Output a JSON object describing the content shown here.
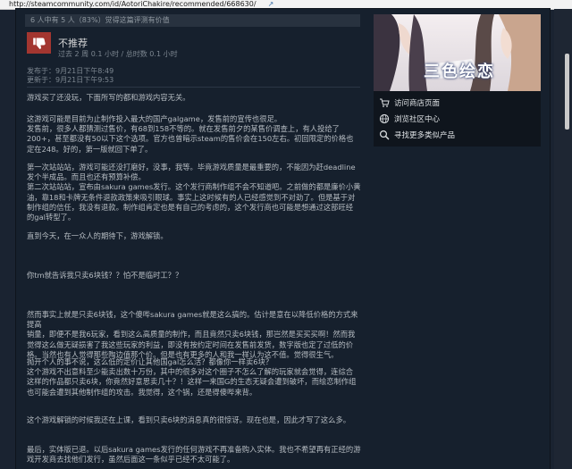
{
  "browser": {
    "url": "http://steamcommunity.com/id/AotoriChakire/recommended/668630/"
  },
  "review": {
    "helpful_text": "6 人中有 5 人（83%）觉得这篇评测有价值",
    "verdict": "不推荐",
    "verdict_icon": "thumbs-down-icon",
    "hours": "过去 2 周 0.1 小时 / 总时数 0.1 小时",
    "posted": "发布于：9月21日下午8:49",
    "updated": "更新于：9月21日下午9:53",
    "paragraphs": [
      [
        "游戏买了还没玩，下面所写的都和游戏内容无关。"
      ],
      [
        "这游戏可能是目前为止制作投入最大的国产galgame，发售前的宣传也很足。",
        "发售前，很多人都猜测过售价，有68到158不等的。就在发售前夕的某售价调查上，有人投给了",
        "200+，甚至都没有50以下这个选项。官方也曾暗示steam的售价会在150左右。初回限定的价格也",
        "定在248。好的，第一版就回下单了。"
      ],
      [
        "第一次站站站，游戏可能还没打磨好，没事，我等。毕竟游戏质量是最重要的，不能因为赶deadline",
        "发个半成品。而且也还有预算补偿。",
        "第二次站站站，宣布由sakura games发行。这个发行商制作组不会不知道吧。之前做的都是廉价小黄",
        "油，靠18和卡牌无条件退款政策来吸引眼球。事实上这时候有的人已经感觉到不对劲了。但是基于对",
        "制作组的信任，我没有退款。制作组肯定也是有自己的考虑的，这个发行商也可能是想通过这部旺经",
        "的gal转型了。"
      ],
      [
        "直到今天，在一众人的期待下，游戏解锁。"
      ],
      [
        "你tm就告诉我只卖6块钱？？怕不是临时工？？"
      ],
      [
        "然而事实上就是只卖6块钱，这个傻哔sakura games就是这么搞的。估计是意在以降低价格的方式来提高",
        "销量，即便不是我6玩家，看到这么高质量的制作，而且竟然只卖6块钱，那岂然是买买买啊！然而我",
        "觉得这么做无疑损害了我这些玩家的利益，即没有按约定时间在发售前发货，数字版也定了过低的价",
        "格。当然也有人觉得那些陶边值那个价。但是也有更多的人和我一样认为这不值。觉得很生气。"
      ],
      [
        "抛开个人的事不说，这么低的定价让其他国gal怎么活？都像你一样卖6块？",
        "这个游戏不出意料至少能卖出数十万份，其中的很多对这个圈子不怎么了解的玩家就会觉得，连综合",
        "这样的作品都只卖6块，你竟然好意思卖几十？！这样一来国G的生态无疑会遭到破坏，而绘恋制作组",
        "也可能会遭到其他制作组的攻击。我觉得，这个锅，还是得傻哔来背。"
      ],
      [
        "这个游戏解锁的时候我还在上课，看到只卖6块的消息真的很惊讶。现在也是，因此才写了这么多。"
      ],
      [
        "最后，实体版已退。以后sakura games发行的任何游戏不再准备购入实体。我也不希望再有正经的游",
        "戏开发商去找他们发行，虽然后面这一条似乎已经不太可能了。"
      ]
    ]
  },
  "sidebar": {
    "game_logo": "三色绘恋",
    "links": [
      {
        "label": "访问商店页面",
        "icon": "cart-icon"
      },
      {
        "label": "浏览社区中心",
        "icon": "globe-icon"
      },
      {
        "label": "寻找更多类似产品",
        "icon": "search-icon"
      }
    ]
  },
  "colors": {
    "thumbs_down_bg": "#a33630",
    "page_bg": "#16202d",
    "text": "#b6bcc2"
  }
}
